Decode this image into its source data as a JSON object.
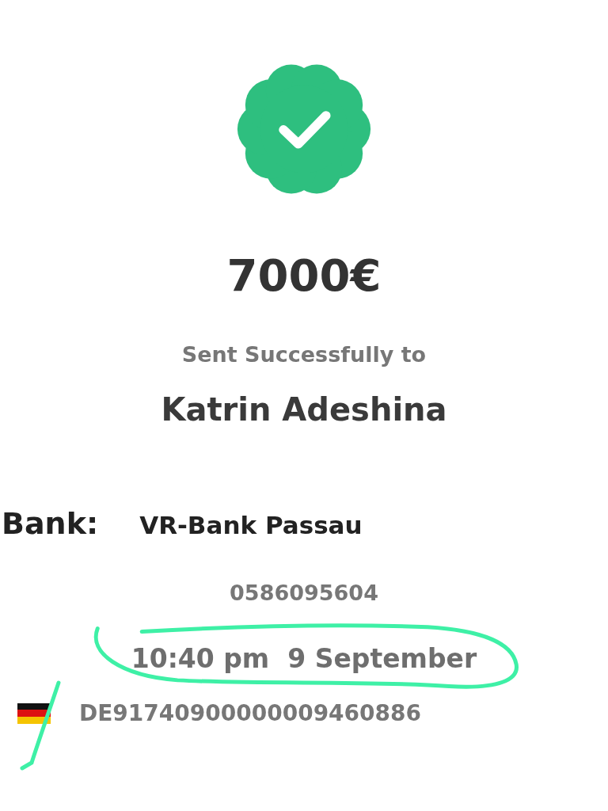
{
  "amount": "7000€",
  "status": "Sent Successfully to",
  "recipient": "Katrin Adeshina",
  "bank": {
    "label": "Bank:",
    "value": "VR-Bank Passau"
  },
  "account_number": "0586095604",
  "datetime": "10:40 pm  9 September",
  "iban": "DE91740900000009460886"
}
